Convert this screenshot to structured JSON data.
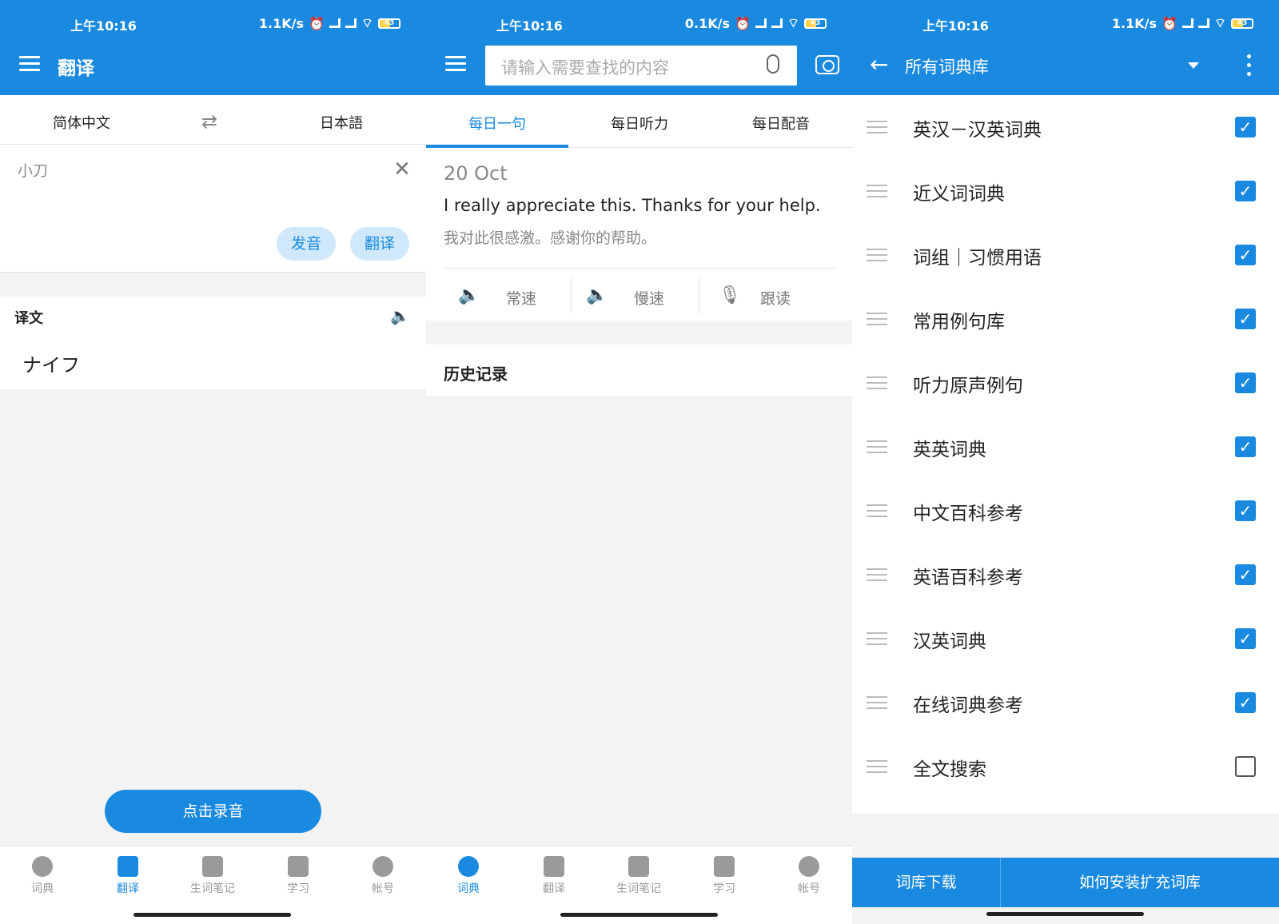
{
  "status": {
    "time": "上午10:16",
    "speed1": "1.1K/s",
    "speed2": "0.1K/s",
    "speed3": "1.1K/s",
    "battery": "43"
  },
  "panel1": {
    "title": "翻译",
    "src_lang": "简体中文",
    "dst_lang": "日本語",
    "input_text": "小刀",
    "pron_btn": "发音",
    "translate_btn": "翻译",
    "result_label": "译文",
    "result_text": "ナイフ",
    "record_btn": "点击录音"
  },
  "panel2": {
    "search_placeholder": "请输入需要查找的内容",
    "tabs": [
      "每日一句",
      "每日听力",
      "每日配音"
    ],
    "date": "20 Oct",
    "sentence_en": "I really appreciate this. Thanks for your help.",
    "sentence_zh": "我对此很感激。感谢你的帮助。",
    "controls": [
      "常速",
      "慢速",
      "跟读"
    ],
    "history_label": "历史记录"
  },
  "panel3": {
    "title": "所有词典库",
    "dictionaries": [
      {
        "name": "英汉－汉英词典",
        "checked": true
      },
      {
        "name": "近义词词典",
        "checked": true
      },
      {
        "name": "词组｜习惯用语",
        "checked": true
      },
      {
        "name": "常用例句库",
        "checked": true
      },
      {
        "name": "听力原声例句",
        "checked": true
      },
      {
        "name": "英英词典",
        "checked": true
      },
      {
        "name": "中文百科参考",
        "checked": true
      },
      {
        "name": "英语百科参考",
        "checked": true
      },
      {
        "name": "汉英词典",
        "checked": true
      },
      {
        "name": "在线词典参考",
        "checked": true
      },
      {
        "name": "全文搜索",
        "checked": false
      }
    ],
    "download_btn": "词库下载",
    "howto_btn": "如何安装扩充词库"
  },
  "nav": [
    "词典",
    "翻译",
    "生词笔记",
    "学习",
    "帐号"
  ],
  "colors": {
    "primary": "#1a8ae0",
    "pill_bg": "#cfe8fb"
  }
}
